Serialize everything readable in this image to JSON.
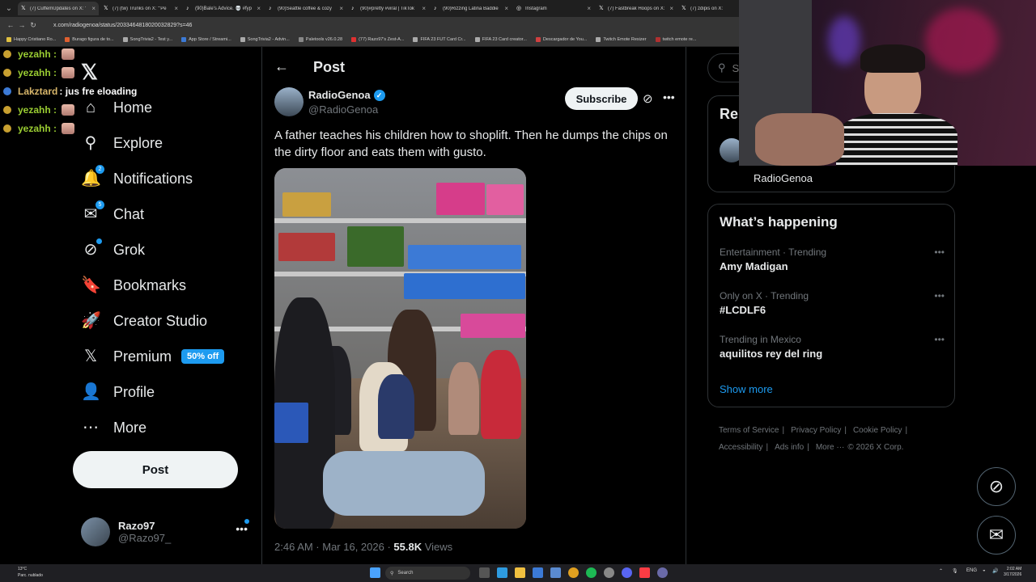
{
  "browser": {
    "tabs": [
      {
        "title": "(7) CuffemUpdates on X: '",
        "active": true
      },
      {
        "title": "(7) (tw) Trunks on X: '\"Pe",
        "active": false
      },
      {
        "title": "(90)Bale's Advice. 💀 #fyp",
        "active": false
      },
      {
        "title": "(90)Seattle coffee & cozy",
        "active": false
      },
      {
        "title": "(90)#pretty #viral | TikTok",
        "active": false
      },
      {
        "title": "(90)Rizzing Latina Baddie",
        "active": false
      },
      {
        "title": "Instagram",
        "active": false
      },
      {
        "title": "(7) Fastbreak Hoops on X:",
        "active": false
      },
      {
        "title": "(7) zdipis on X:",
        "active": false
      }
    ],
    "url": "x.com/radiogenoa/status/2033464818020032829?s=46",
    "bookmarks": [
      "Happy Cristiano Ro...",
      "Burago figura de to...",
      "SongTrivia2 - Test y...",
      "App Store / Streami...",
      "SongTrivia2 - Advin...",
      "Paletools v26.0.28",
      "(77) Razo97's Zest-A...",
      "FIFA 23 FUT Card Cr...",
      "FIFA 23 Card creator...",
      "Descargador de You...",
      "Twitch Emote Resizer",
      "twitch emote re..."
    ]
  },
  "chat": [
    {
      "user": "yezahh :",
      "color": "#9acd32",
      "text": ""
    },
    {
      "user": "yezahh :",
      "color": "#9acd32",
      "text": ""
    },
    {
      "user": "Lakztard",
      "color": "#d8b66a",
      "text": ": jus fre eloading"
    },
    {
      "user": "yezahh :",
      "color": "#9acd32",
      "text": ""
    },
    {
      "user": "yezahh :",
      "color": "#9acd32",
      "text": ""
    }
  ],
  "sidebar": {
    "items": [
      {
        "label": "Home",
        "icon": "home-icon",
        "glyph": "⌂"
      },
      {
        "label": "Explore",
        "icon": "search-icon",
        "glyph": "⚲"
      },
      {
        "label": "Notifications",
        "icon": "bell-icon",
        "glyph": "🔔",
        "badge": "2"
      },
      {
        "label": "Chat",
        "icon": "mail-icon",
        "glyph": "✉",
        "badge": "5"
      },
      {
        "label": "Grok",
        "icon": "grok-icon",
        "glyph": "⊘",
        "dot": true
      },
      {
        "label": "Bookmarks",
        "icon": "bookmark-icon",
        "glyph": "🔖"
      },
      {
        "label": "Creator Studio",
        "icon": "rocket-icon",
        "glyph": "🚀"
      },
      {
        "label": "Premium",
        "icon": "x-premium-icon",
        "glyph": "𝕏",
        "pill": "50% off"
      },
      {
        "label": "Profile",
        "icon": "person-icon",
        "glyph": "👤"
      },
      {
        "label": "More",
        "icon": "more-circle-icon",
        "glyph": "⋯"
      }
    ],
    "post_label": "Post",
    "account": {
      "name": "Razo97",
      "handle": "@Razo97_"
    }
  },
  "post": {
    "header_title": "Post",
    "author_name": "RadioGenoa",
    "author_handle": "@RadioGenoa",
    "subscribe_label": "Subscribe",
    "text": "A father teaches his children how to shoplift. Then he dumps the chips on the dirty floor and eats them with gusto.",
    "timestamp": "2:46 AM · Mar 16, 2026 · ",
    "views_count": "55.8K",
    "views_label": " Views"
  },
  "right": {
    "search_placeholder": "Se",
    "relevant_title": "Rel",
    "relevant_name": "RadioGenoa",
    "happening_title": "What’s happening",
    "trends": [
      {
        "category": "Entertainment · Trending",
        "name": "Amy Madigan"
      },
      {
        "category": "Only on X · Trending",
        "name": "#LCDLF6"
      },
      {
        "category": "Trending in Mexico",
        "name": "aquilitos rey del ring"
      }
    ],
    "show_more": "Show more",
    "footer": [
      "Terms of Service",
      "Privacy Policy",
      "Cookie Policy",
      "Accessibility",
      "Ads info",
      "More ···",
      "© 2026 X Corp."
    ]
  },
  "taskbar": {
    "weather_temp": "13°C",
    "weather_desc": "Parc. nublado",
    "search_label": "Search",
    "lang": "ENG",
    "time": "2:02 AM",
    "date": "3/17/2026"
  },
  "colors": {
    "accent": "#1d9bf0",
    "background": "#000000",
    "text": "#e7e9ea",
    "muted": "#71767b"
  }
}
